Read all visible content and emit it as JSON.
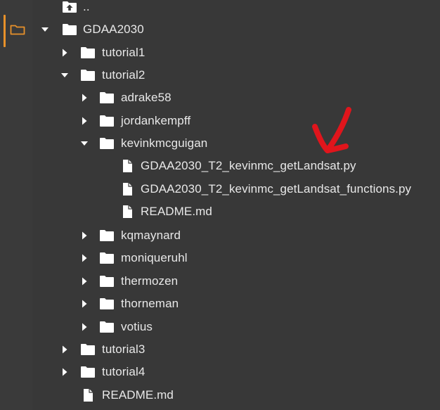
{
  "colors": {
    "background": "#383838",
    "text": "#e8e8e8",
    "icon": "#ffffff",
    "active_indicator": "#e8912a",
    "annotation": "#e0151c"
  },
  "activity_bar": {
    "active_tab_icon": "folder-icon"
  },
  "tree": [
    {
      "label": "..",
      "kind": "parent-dir",
      "depth": 0,
      "twisty": "none",
      "icon": "folder-up-icon",
      "name": "parent-dir"
    },
    {
      "label": "GDAA2030",
      "kind": "folder",
      "depth": 0,
      "twisty": "expanded",
      "icon": "folder-icon",
      "name": "gdaa2030"
    },
    {
      "label": "tutorial1",
      "kind": "folder",
      "depth": 1,
      "twisty": "collapsed",
      "icon": "folder-icon",
      "name": "tutorial1"
    },
    {
      "label": "tutorial2",
      "kind": "folder",
      "depth": 1,
      "twisty": "expanded",
      "icon": "folder-icon",
      "name": "tutorial2"
    },
    {
      "label": "adrake58",
      "kind": "folder",
      "depth": 2,
      "twisty": "collapsed",
      "icon": "folder-icon",
      "name": "adrake58"
    },
    {
      "label": "jordankempff",
      "kind": "folder",
      "depth": 2,
      "twisty": "collapsed",
      "icon": "folder-icon",
      "name": "jordankempff"
    },
    {
      "label": "kevinkmcguigan",
      "kind": "folder",
      "depth": 2,
      "twisty": "expanded",
      "icon": "folder-icon",
      "name": "kevinkmcguigan"
    },
    {
      "label": "GDAA2030_T2_kevinmc_getLandsat.py",
      "kind": "file",
      "depth": 3,
      "twisty": "none",
      "icon": "file-icon",
      "name": "getlandsat-py"
    },
    {
      "label": "GDAA2030_T2_kevinmc_getLandsat_functions.py",
      "kind": "file",
      "depth": 3,
      "twisty": "none",
      "icon": "file-icon",
      "name": "getlandsat-functions-py"
    },
    {
      "label": "README.md",
      "kind": "file",
      "depth": 3,
      "twisty": "none",
      "icon": "file-icon",
      "name": "kevinkmcguigan-readme"
    },
    {
      "label": "kqmaynard",
      "kind": "folder",
      "depth": 2,
      "twisty": "collapsed",
      "icon": "folder-icon",
      "name": "kqmaynard"
    },
    {
      "label": "moniqueruhl",
      "kind": "folder",
      "depth": 2,
      "twisty": "collapsed",
      "icon": "folder-icon",
      "name": "moniqueruhl"
    },
    {
      "label": "thermozen",
      "kind": "folder",
      "depth": 2,
      "twisty": "collapsed",
      "icon": "folder-icon",
      "name": "thermozen"
    },
    {
      "label": "thorneman",
      "kind": "folder",
      "depth": 2,
      "twisty": "collapsed",
      "icon": "folder-icon",
      "name": "thorneman"
    },
    {
      "label": "votius",
      "kind": "folder",
      "depth": 2,
      "twisty": "collapsed",
      "icon": "folder-icon",
      "name": "votius"
    },
    {
      "label": "tutorial3",
      "kind": "folder",
      "depth": 1,
      "twisty": "collapsed",
      "icon": "folder-icon",
      "name": "tutorial3"
    },
    {
      "label": "tutorial4",
      "kind": "folder",
      "depth": 1,
      "twisty": "collapsed",
      "icon": "folder-icon",
      "name": "tutorial4"
    },
    {
      "label": "README.md",
      "kind": "file",
      "depth": 1,
      "twisty": "none",
      "icon": "file-icon",
      "name": "gdaa2030-readme"
    }
  ],
  "annotation": {
    "shape": "check-arrow",
    "points_to": "GDAA2030_T2_kevinmc_getLandsat.py"
  }
}
